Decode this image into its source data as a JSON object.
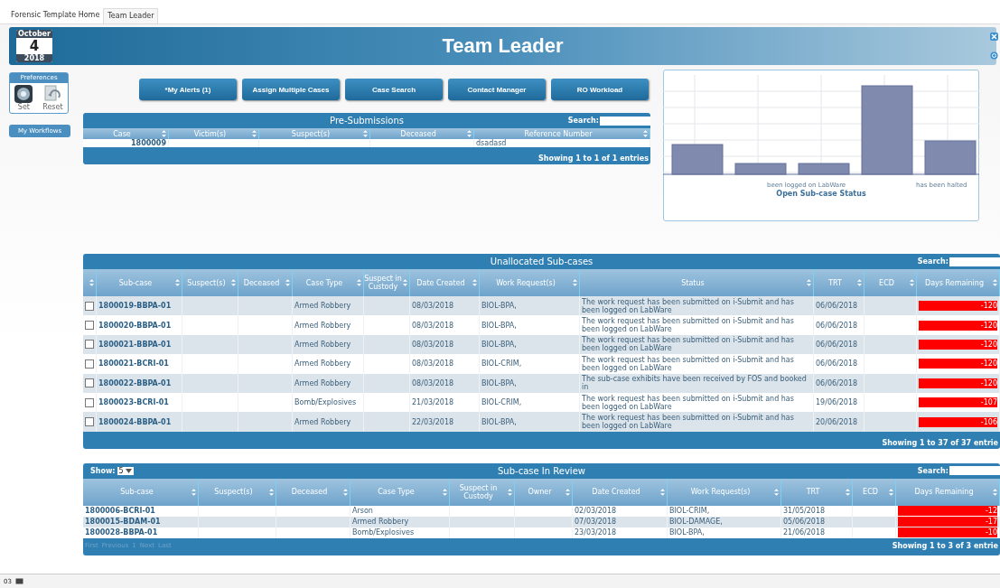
{
  "tabs": [
    {
      "label": "Forensic Template Home",
      "selected": false
    },
    {
      "label": "Team Leader",
      "selected": true
    }
  ],
  "header": {
    "calendar": {
      "month": "October",
      "day": "4",
      "year": "2018"
    },
    "title": "Team Leader"
  },
  "sidebar": {
    "preferences": {
      "title": "Preferences",
      "actions": [
        {
          "kind": "set",
          "label": "Set"
        },
        {
          "kind": "reset",
          "label": "Reset"
        }
      ]
    },
    "workflows": "My Workflows"
  },
  "buttons": [
    "*My Alerts (1)",
    "Assign Multiple Cases",
    "Case Search",
    "Contact Manager",
    "RO Workload"
  ],
  "pre_submissions": {
    "title": "Pre-Submissions",
    "search_label": "Search:",
    "columns": [
      "Case",
      "Victim(s)",
      "Suspect(s)",
      "Deceased",
      "Reference Number"
    ],
    "rows": [
      [
        "1800009",
        "",
        "",
        "",
        "dsadasd"
      ]
    ],
    "footer": "Showing 1 to 1 of 1 entries"
  },
  "chart": {
    "title": "Open Sub-case Status",
    "label_lines": [
      "been logged on LabWare",
      "has been halted"
    ]
  },
  "unallocated": {
    "title": "Unallocated Sub-cases",
    "search_label": "Search:",
    "columns": [
      "Sub-case",
      "Suspect(s)",
      "Deceased",
      "Case Type",
      "Suspect in Custody",
      "Date Created",
      "Work Request(s)",
      "Status",
      "TRT",
      "ECD",
      "Days Remaining"
    ],
    "rows": [
      {
        "checked": false,
        "cells": [
          "1800019-BBPA-01",
          "",
          "",
          "Armed Robbery",
          "",
          "08/03/2018",
          "BIOL-BPA,",
          "The work request has been submitted on i-Submit and has been logged on LabWare",
          "06/06/2018",
          "",
          "-120"
        ]
      },
      {
        "checked": false,
        "cells": [
          "1800020-BBPA-01",
          "",
          "",
          "Armed Robbery",
          "",
          "08/03/2018",
          "BIOL-BPA,",
          "The work request has been submitted on i-Submit and has been logged on LabWare",
          "06/06/2018",
          "",
          "-120"
        ]
      },
      {
        "checked": false,
        "cells": [
          "1800021-BBPA-01",
          "",
          "",
          "Armed Robbery",
          "",
          "08/03/2018",
          "BIOL-BPA,",
          "The work request has been submitted on i-Submit and has been logged on LabWare",
          "06/06/2018",
          "",
          "-120"
        ]
      },
      {
        "checked": false,
        "cells": [
          "1800021-BCRI-01",
          "",
          "",
          "Armed Robbery",
          "",
          "08/03/2018",
          "BIOL-CRIM,",
          "The work request has been submitted on i-Submit and has been logged on LabWare",
          "06/06/2018",
          "",
          "-120"
        ]
      },
      {
        "checked": false,
        "cells": [
          "1800022-BBPA-01",
          "",
          "",
          "Armed Robbery",
          "",
          "08/03/2018",
          "BIOL-BPA,",
          "The sub-case exhibits have been received by FOS and booked in",
          "06/06/2018",
          "",
          "-120"
        ]
      },
      {
        "checked": false,
        "cells": [
          "1800023-BCRI-01",
          "",
          "",
          "Bomb/Explosives",
          "",
          "21/03/2018",
          "BIOL-CRIM,",
          "The work request has been submitted on i-Submit and has been logged on LabWare",
          "19/06/2018",
          "",
          "-107"
        ]
      },
      {
        "checked": false,
        "cells": [
          "1800024-BBPA-01",
          "",
          "",
          "Armed Robbery",
          "",
          "22/03/2018",
          "BIOL-BPA,",
          "The work request has been submitted on i-Submit and has been logged on LabWare",
          "20/06/2018",
          "",
          "-106"
        ]
      }
    ],
    "footer": "Showing 1 to 37 of 37 entrie"
  },
  "review": {
    "show_label": "Show:",
    "show_value": "5",
    "title": "Sub-case In Review",
    "search_label": "Search:",
    "columns": [
      "Sub-case",
      "Suspect(s)",
      "Deceased",
      "Case Type",
      "Suspect in Custody",
      "Owner",
      "Date Created",
      "Work Request(s)",
      "TRT",
      "ECD",
      "Days Remaining"
    ],
    "rows": [
      [
        "1800006-BCRI-01",
        "",
        "",
        "Arson",
        "",
        "",
        "02/03/2018",
        "BIOL-CRIM,",
        "31/05/2018",
        "",
        "-12"
      ],
      [
        "1800015-BDAM-01",
        "",
        "",
        "Armed Robbery",
        "",
        "",
        "07/03/2018",
        "BIOL-DAMAGE,",
        "05/06/2018",
        "",
        "-17"
      ],
      [
        "1800028-BBPA-01",
        "",
        "",
        "Bomb/Explosives",
        "",
        "",
        "23/03/2018",
        "BIOL-BPA,",
        "21/06/2018",
        "",
        "-10"
      ]
    ],
    "pagination": [
      {
        "label": "First",
        "disabled": true
      },
      {
        "label": "Previous",
        "disabled": true
      },
      {
        "label": "1",
        "disabled": true
      },
      {
        "label": "Next",
        "disabled": true
      },
      {
        "label": "Last",
        "disabled": true
      }
    ],
    "footer": "Showing 1 to 3 of 3 entrie"
  },
  "status_bar": {
    "text": "03"
  }
}
